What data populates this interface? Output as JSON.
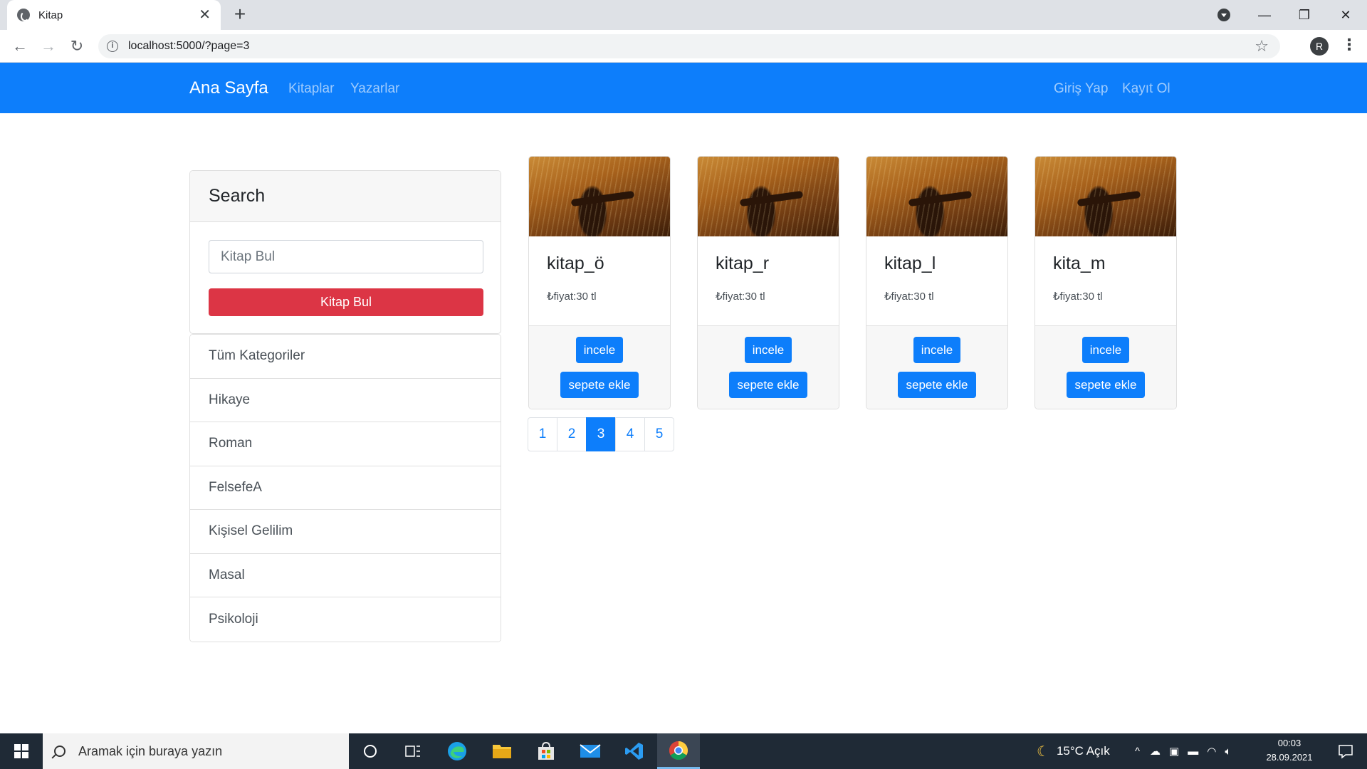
{
  "browser": {
    "tab_title": "Kitap",
    "url": "localhost:5000/?page=3",
    "profile_initial": "R"
  },
  "navbar": {
    "brand": "Ana Sayfa",
    "links": [
      "Kitaplar",
      "Yazarlar"
    ],
    "login": "Giriş Yap",
    "register": "Kayıt Ol"
  },
  "search": {
    "heading": "Search",
    "placeholder": "Kitap Bul",
    "button": "Kitap Bul"
  },
  "categories": [
    "Tüm Kategoriler",
    "Hikaye",
    "Roman",
    "FelsefeA",
    "Kişisel Gelilim",
    "Masal",
    "Psikoloji"
  ],
  "products": [
    {
      "title": "kitap_ö",
      "price": "₺fiyat:30 tl",
      "view_label": "incele",
      "cart_label": "sepete ekle"
    },
    {
      "title": "kitap_r",
      "price": "₺fiyat:30 tl",
      "view_label": "incele",
      "cart_label": "sepete ekle"
    },
    {
      "title": "kitap_l",
      "price": "₺fiyat:30 tl",
      "view_label": "incele",
      "cart_label": "sepete ekle"
    },
    {
      "title": "kita_m",
      "price": "₺fiyat:30 tl",
      "view_label": "incele",
      "cart_label": "sepete ekle"
    }
  ],
  "pagination": {
    "pages": [
      "1",
      "2",
      "3",
      "4",
      "5"
    ],
    "active_page": "3"
  },
  "taskbar": {
    "search_placeholder": "Aramak için buraya yazın",
    "weather": "15°C  Açık",
    "time": "00:03",
    "date": "28.09.2021"
  },
  "colors": {
    "primary": "#0d7efb",
    "danger": "#dc3545",
    "navbar": "#0d7efb"
  }
}
